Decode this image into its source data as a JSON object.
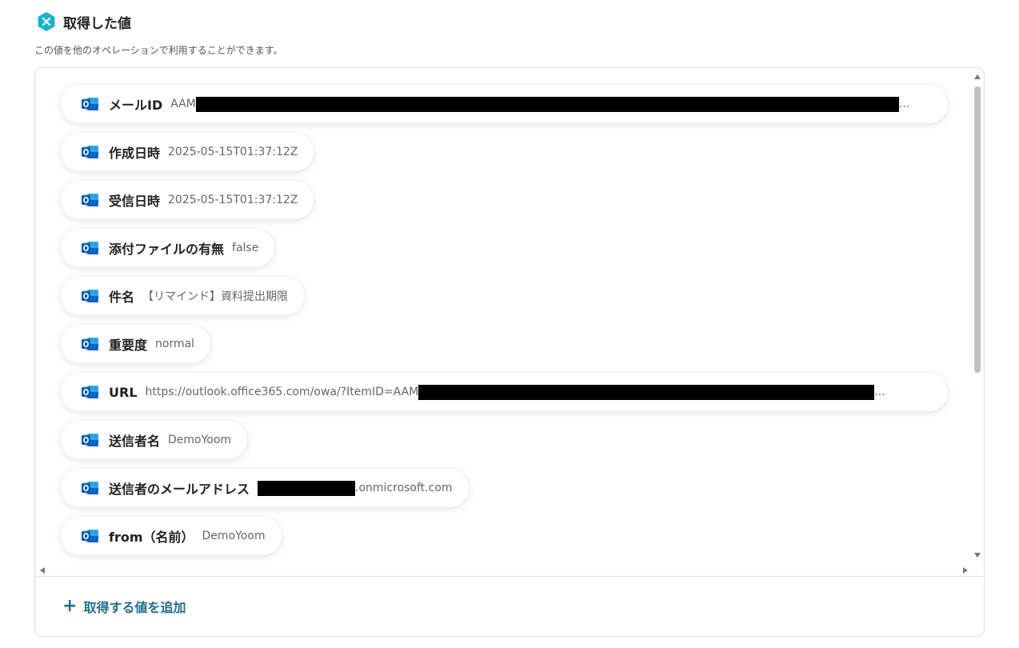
{
  "header": {
    "title": "取得した値",
    "subtitle": "この値を他のオペレーションで利用することができます。",
    "icon": "yoom-hex-icon"
  },
  "colors": {
    "accent": "#1f6f8b",
    "outlook_blue": "#0a64c8",
    "hex_icon": "#14b4d2"
  },
  "fields": [
    {
      "label": "メールID",
      "value_prefix": "AAM",
      "value_suffix": "...",
      "redacted": true
    },
    {
      "label": "作成日時",
      "value": "2025-05-15T01:37:12Z"
    },
    {
      "label": "受信日時",
      "value": "2025-05-15T01:37:12Z"
    },
    {
      "label": "添付ファイルの有無",
      "value": "false"
    },
    {
      "label": "件名",
      "value": "【リマインド】資料提出期限"
    },
    {
      "label": "重要度",
      "value": "normal"
    },
    {
      "label": "URL",
      "value_prefix": "https://outlook.office365.com/owa/?ItemID=AAM",
      "value_suffix": "...",
      "redacted": true
    },
    {
      "label": "送信者名",
      "value": "DemoYoom"
    },
    {
      "label": "送信者のメールアドレス",
      "value_prefix": "",
      "value_suffix": ".onmicrosoft.com",
      "redacted": true
    },
    {
      "label": "from（名前）",
      "value": "DemoYoom"
    }
  ],
  "footer": {
    "add_label": "取得する値を追加",
    "add_icon": "plus-icon"
  }
}
